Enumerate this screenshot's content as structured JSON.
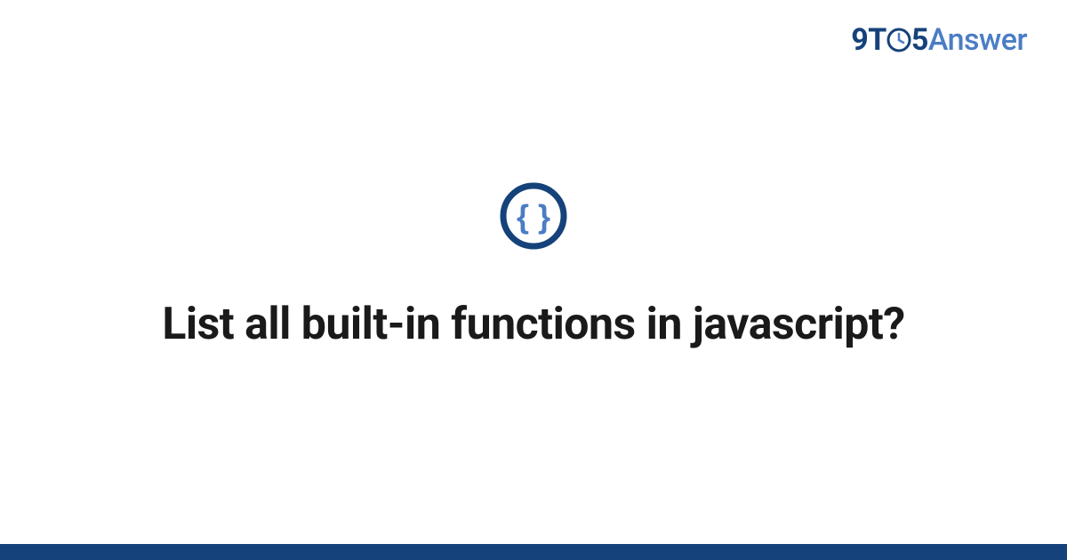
{
  "logo": {
    "part1": "9T",
    "part2": "5",
    "part3": "Answer"
  },
  "icon": {
    "name": "code-braces-icon"
  },
  "title": "List all built-in functions in javascript?",
  "colors": {
    "primary": "#15427a",
    "accent": "#4a7dc4"
  }
}
